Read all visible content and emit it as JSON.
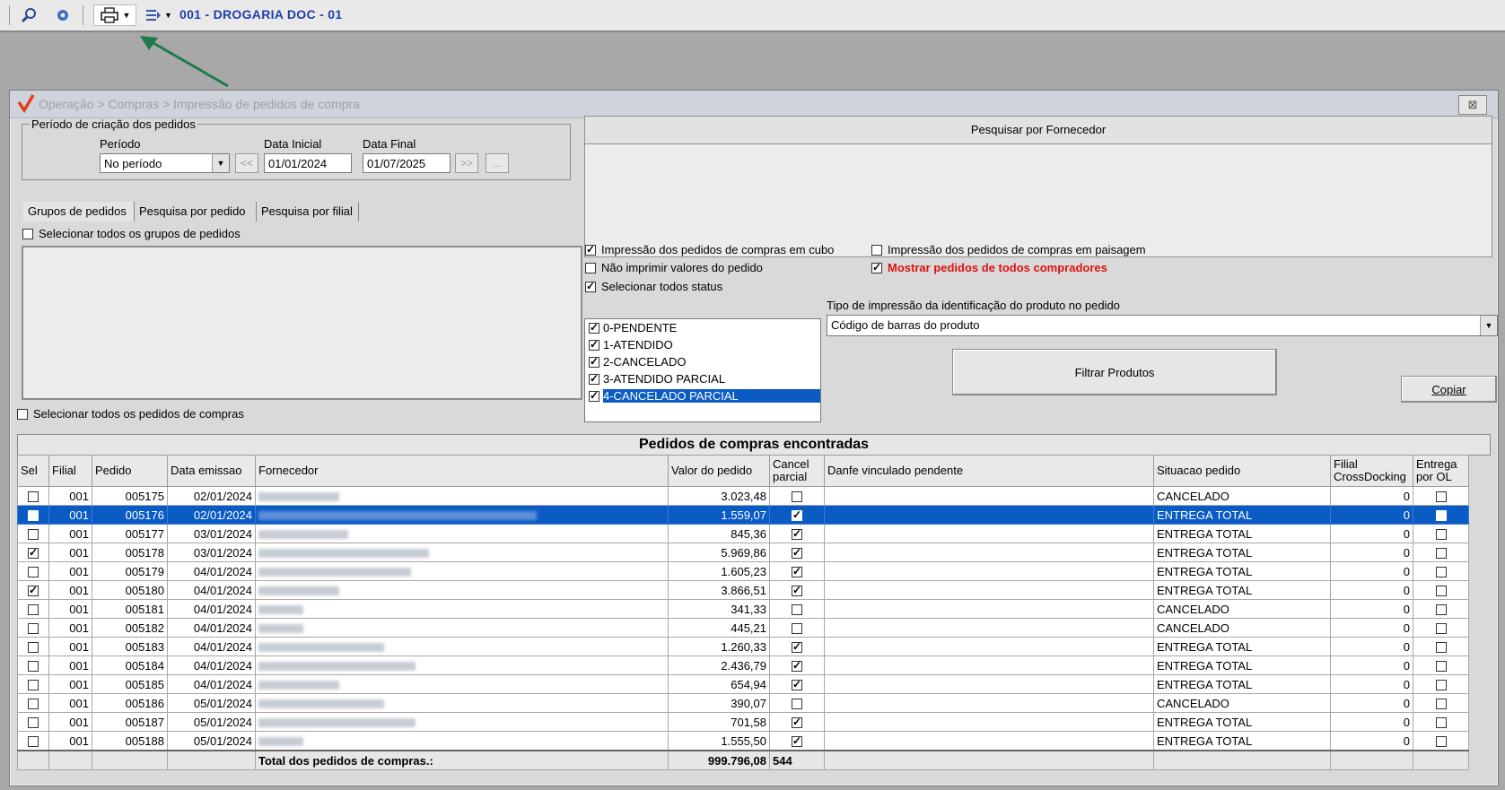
{
  "toolbar": {
    "company_label": "001 - DROGARIA DOC - 01"
  },
  "window": {
    "title": "Operação > Compras > Impressão de pedidos de compra",
    "close_label": "⊠"
  },
  "period": {
    "legend": "Período de criação dos pedidos",
    "period_label": "Período",
    "period_value": "No período",
    "start_label": "Data Inicial",
    "start_value": "01/01/2024",
    "end_label": "Data Final",
    "end_value": "01/07/2025",
    "prev_btn": "<<",
    "next_btn": ">>",
    "more_btn": "..."
  },
  "tabs": [
    "Grupos de pedidos",
    "Pesquisa por pedido",
    "Pesquisa por filial"
  ],
  "groups": {
    "select_all_label": "Selecionar todos os grupos de pedidos",
    "select_all_orders_label": "Selecionar todos os pedidos de compras"
  },
  "supplier_search": {
    "header": "Pesquisar por Fornecedor"
  },
  "options": {
    "cube": "Impressão dos pedidos de compras em cubo",
    "landscape": "Impressão dos pedidos de compras em paisagem",
    "no_values": "Não imprimir valores do pedido",
    "all_buyers": "Mostrar pedidos de todos compradores",
    "all_status": "Selecionar todos status"
  },
  "statuses": [
    "0-PENDENTE",
    "1-ATENDIDO",
    "2-CANCELADO",
    "3-ATENDIDO PARCIAL",
    "4-CANCELADO PARCIAL"
  ],
  "print_type": {
    "label": "Tipo de impressão da identificação do produto no pedido",
    "value": "Código de barras do produto"
  },
  "buttons": {
    "filter": "Filtrar Produtos",
    "copy": "Copiar"
  },
  "grid": {
    "title": "Pedidos de compras encontradas",
    "columns": [
      "Sel",
      "Filial",
      "Pedido",
      "Data emissao",
      "Fornecedor",
      "Valor do pedido",
      "Cancel parcial",
      "Danfe vinculado pendente",
      "Situacao pedido",
      "Filial CrossDocking",
      "Entrega por OL"
    ],
    "rows": [
      {
        "sel": false,
        "filial": "001",
        "pedido": "005175",
        "data": "02/01/2024",
        "forn_w": 90,
        "valor": "3.023,48",
        "cancel": false,
        "situacao": "CANCELADO",
        "cross": "0",
        "selected": false
      },
      {
        "sel": false,
        "filial": "001",
        "pedido": "005176",
        "data": "02/01/2024",
        "forn_w": 310,
        "valor": "1.559,07",
        "cancel": true,
        "situacao": "ENTREGA TOTAL",
        "cross": "0",
        "selected": true
      },
      {
        "sel": false,
        "filial": "001",
        "pedido": "005177",
        "data": "03/01/2024",
        "forn_w": 100,
        "valor": "845,36",
        "cancel": true,
        "situacao": "ENTREGA TOTAL",
        "cross": "0",
        "selected": false
      },
      {
        "sel": true,
        "filial": "001",
        "pedido": "005178",
        "data": "03/01/2024",
        "forn_w": 190,
        "valor": "5.969,86",
        "cancel": true,
        "situacao": "ENTREGA TOTAL",
        "cross": "0",
        "selected": false
      },
      {
        "sel": false,
        "filial": "001",
        "pedido": "005179",
        "data": "04/01/2024",
        "forn_w": 170,
        "valor": "1.605,23",
        "cancel": true,
        "situacao": "ENTREGA TOTAL",
        "cross": "0",
        "selected": false
      },
      {
        "sel": true,
        "filial": "001",
        "pedido": "005180",
        "data": "04/01/2024",
        "forn_w": 90,
        "valor": "3.866,51",
        "cancel": true,
        "situacao": "ENTREGA TOTAL",
        "cross": "0",
        "selected": false
      },
      {
        "sel": false,
        "filial": "001",
        "pedido": "005181",
        "data": "04/01/2024",
        "forn_w": 50,
        "valor": "341,33",
        "cancel": false,
        "situacao": "CANCELADO",
        "cross": "0",
        "selected": false
      },
      {
        "sel": false,
        "filial": "001",
        "pedido": "005182",
        "data": "04/01/2024",
        "forn_w": 50,
        "valor": "445,21",
        "cancel": false,
        "situacao": "CANCELADO",
        "cross": "0",
        "selected": false
      },
      {
        "sel": false,
        "filial": "001",
        "pedido": "005183",
        "data": "04/01/2024",
        "forn_w": 140,
        "valor": "1.260,33",
        "cancel": true,
        "situacao": "ENTREGA TOTAL",
        "cross": "0",
        "selected": false
      },
      {
        "sel": false,
        "filial": "001",
        "pedido": "005184",
        "data": "04/01/2024",
        "forn_w": 175,
        "valor": "2.436,79",
        "cancel": true,
        "situacao": "ENTREGA TOTAL",
        "cross": "0",
        "selected": false
      },
      {
        "sel": false,
        "filial": "001",
        "pedido": "005185",
        "data": "04/01/2024",
        "forn_w": 90,
        "valor": "654,94",
        "cancel": true,
        "situacao": "ENTREGA TOTAL",
        "cross": "0",
        "selected": false
      },
      {
        "sel": false,
        "filial": "001",
        "pedido": "005186",
        "data": "05/01/2024",
        "forn_w": 140,
        "valor": "390,07",
        "cancel": false,
        "situacao": "CANCELADO",
        "cross": "0",
        "selected": false
      },
      {
        "sel": false,
        "filial": "001",
        "pedido": "005187",
        "data": "05/01/2024",
        "forn_w": 175,
        "valor": "701,58",
        "cancel": true,
        "situacao": "ENTREGA TOTAL",
        "cross": "0",
        "selected": false
      },
      {
        "sel": false,
        "filial": "001",
        "pedido": "005188",
        "data": "05/01/2024",
        "forn_w": 50,
        "valor": "1.555,50",
        "cancel": true,
        "situacao": "ENTREGA TOTAL",
        "cross": "0",
        "selected": false
      }
    ],
    "total_label": "Total dos pedidos de compras.:",
    "total_value": "999.796,08",
    "total_count": "544"
  }
}
